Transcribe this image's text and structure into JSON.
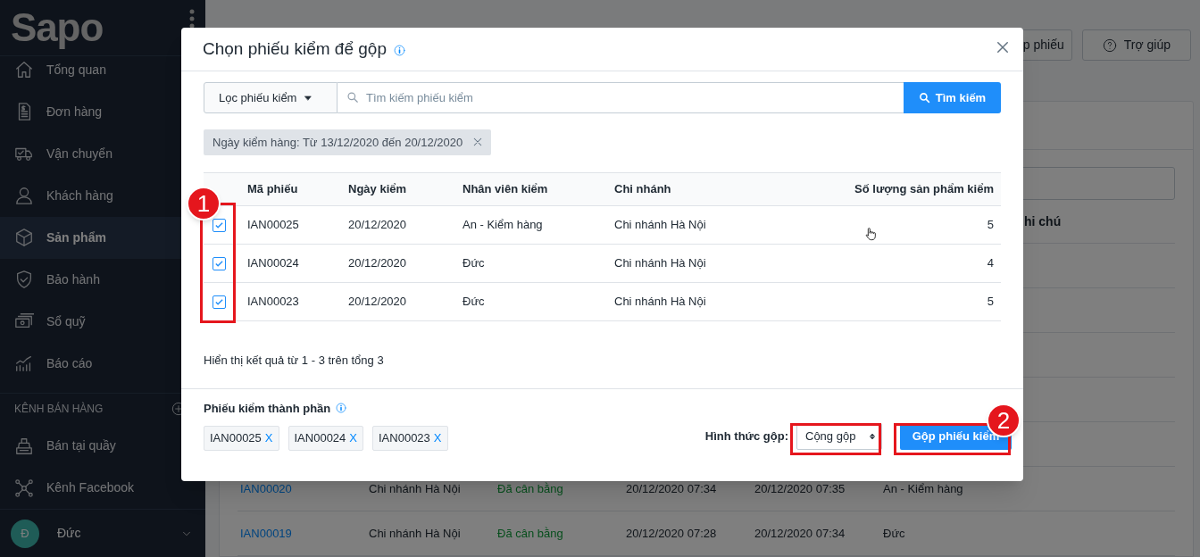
{
  "sidebar": {
    "logo": "Sapo",
    "items": [
      {
        "kind": "home",
        "label": "Tổng quan",
        "selected": false
      },
      {
        "kind": "invoice",
        "label": "Đơn hàng",
        "selected": false
      },
      {
        "kind": "truck",
        "label": "Vận chuyển",
        "selected": false
      },
      {
        "kind": "person",
        "label": "Khách hàng",
        "selected": false
      },
      {
        "kind": "box",
        "label": "Sản phẩm",
        "selected": true
      },
      {
        "kind": "shield",
        "label": "Bảo hành",
        "selected": false
      },
      {
        "kind": "cash",
        "label": "Sổ quỹ",
        "selected": false
      },
      {
        "kind": "chart",
        "label": "Báo cáo",
        "selected": false
      }
    ],
    "section": "KÊNH BÁN HÀNG",
    "channels": [
      {
        "kind": "register",
        "label": "Bán tại quầy",
        "selected": false
      },
      {
        "kind": "network",
        "label": "Kênh Facebook",
        "selected": false
      }
    ],
    "user": {
      "initial": "Đ",
      "name": "Đức"
    }
  },
  "background": {
    "buttons": [
      {
        "kind": "plain",
        "label": "p phiếu"
      },
      {
        "kind": "help",
        "label": "Trợ giúp"
      }
    ],
    "column_header": "hi chú",
    "rows": [
      {
        "cells": [
          "IAN00020",
          "Chi nhánh Hà Nội",
          "Đã cân bằng",
          "20/12/2020 07:34",
          "20/12/2020 07:35",
          "An - Kiểm hàng"
        ]
      },
      {
        "cells": [
          "IAN00019",
          "Chi nhánh Hà Nội",
          "Đã cân bằng",
          "20/12/2020 07:28",
          "20/12/2020 07:34",
          "Đức"
        ]
      }
    ]
  },
  "modal": {
    "title": "Chọn phiếu kiểm để gộp",
    "filter_dropdown": "Lọc phiếu kiểm",
    "search": {
      "placeholder": "Tìm kiếm phiếu kiểm"
    },
    "search_button": "Tìm kiếm",
    "filter_tag": "Ngày kiểm hàng: Từ 13/12/2020 đến 20/12/2020",
    "table": {
      "columns": [
        "Mã phiếu",
        "Ngày kiểm",
        "Nhân viên kiểm",
        "Chi nhánh",
        "Số lượng sản phẩm kiểm"
      ],
      "rows": [
        {
          "checked": true,
          "cells": [
            "IAN00025",
            "20/12/2020",
            "An - Kiểm hàng",
            "Chi nhánh Hà Nội",
            "5"
          ]
        },
        {
          "checked": true,
          "cells": [
            "IAN00024",
            "20/12/2020",
            "Đức",
            "Chi nhánh Hà Nội",
            "4"
          ]
        },
        {
          "checked": true,
          "cells": [
            "IAN00023",
            "20/12/2020",
            "Đức",
            "Chi nhánh Hà Nội",
            "5"
          ]
        }
      ]
    },
    "summary": "Hiển thị kết quả từ 1 - 3 trên tổng 3",
    "components_label": "Phiếu kiểm thành phần",
    "components": [
      {
        "code": "IAN00025",
        "remove": "X"
      },
      {
        "code": "IAN00024",
        "remove": "X"
      },
      {
        "code": "IAN00023",
        "remove": "X"
      }
    ],
    "merge_label": "Hình thức gộp:",
    "merge_select": "Cộng gộp",
    "submit": "Gộp phiếu kiểm",
    "annotations": [
      "1",
      "2"
    ]
  }
}
